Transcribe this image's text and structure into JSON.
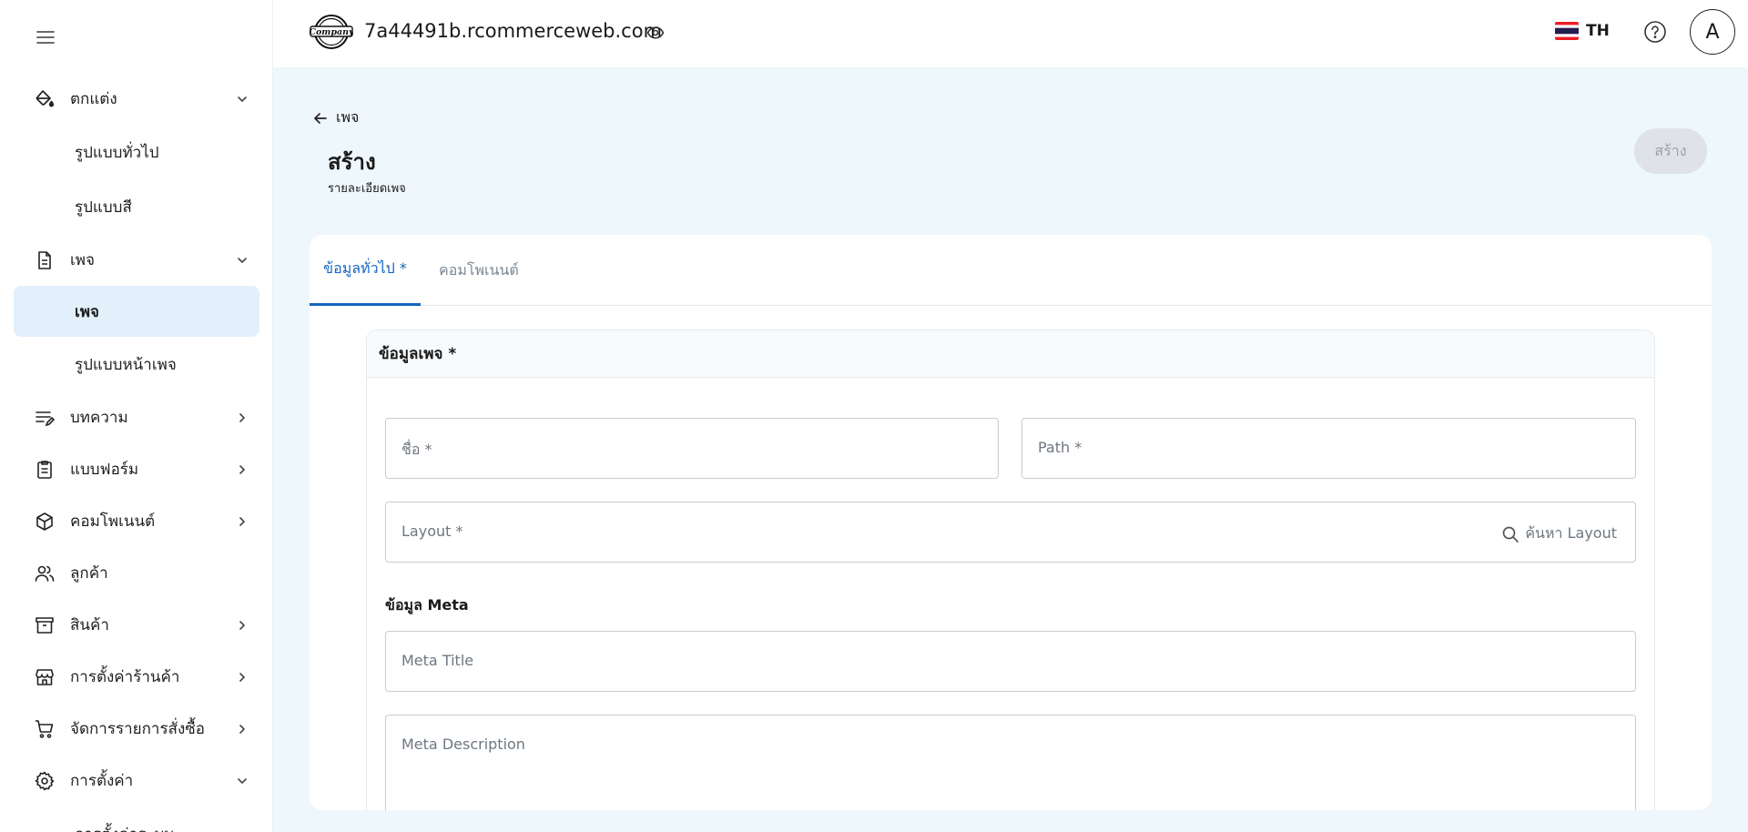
{
  "sidebar": {
    "items": [
      {
        "label": "ตกแต่ง",
        "icon": "paint-bucket-icon",
        "chevron": "down"
      },
      {
        "label": "รูปแบบทั่วไป"
      },
      {
        "label": "รูปแบบสี"
      },
      {
        "label": "เพจ",
        "icon": "document-icon",
        "chevron": "down"
      },
      {
        "label": "เพจ",
        "active": true
      },
      {
        "label": "รูปแบบหน้าเพจ"
      },
      {
        "label": "บทความ",
        "icon": "article-edit-icon",
        "chevron": "right"
      },
      {
        "label": "แบบฟอร์ม",
        "icon": "clipboard-icon",
        "chevron": "right"
      },
      {
        "label": "คอมโพเนนต์",
        "icon": "cube-icon",
        "chevron": "right"
      },
      {
        "label": "ลูกค้า",
        "icon": "users-icon"
      },
      {
        "label": "สินค้า",
        "icon": "archive-box-icon",
        "chevron": "right"
      },
      {
        "label": "การตั้งค่าร้านค้า",
        "icon": "storefront-icon",
        "chevron": "right"
      },
      {
        "label": "จัดการรายการสั่งซื้อ",
        "icon": "cart-icon",
        "chevron": "right"
      },
      {
        "label": "การตั้งค่า",
        "icon": "gear-icon",
        "chevron": "down"
      },
      {
        "label": "การตั้งค่าระบบ"
      }
    ]
  },
  "header": {
    "logo_text": "Company",
    "site": "7a44491b.rcommerceweb.com",
    "lang": "TH",
    "avatar": "A"
  },
  "main": {
    "back_label": "เพจ",
    "title": "สร้าง",
    "subtitle": "รายละเอียดเพจ",
    "create_label": "สร้าง",
    "tabs": [
      {
        "label": "ข้อมูลทั่วไป *",
        "active": true
      },
      {
        "label": "คอมโพเนนต์"
      }
    ],
    "section_title": "ข้อมูลเพจ *",
    "fields": {
      "name": "ชื่อ *",
      "path": "Path *",
      "layout": "Layout *",
      "layout_search": "ค้นหา Layout",
      "meta_label": "ข้อมูล Meta",
      "meta_title": "Meta Title",
      "meta_description": "Meta Description"
    }
  },
  "colors": {
    "accent": "#1565c0",
    "active_bg": "#e3f0fc",
    "page_bg": "#eef7fb",
    "button_disabled_bg": "#dfe3e7"
  }
}
